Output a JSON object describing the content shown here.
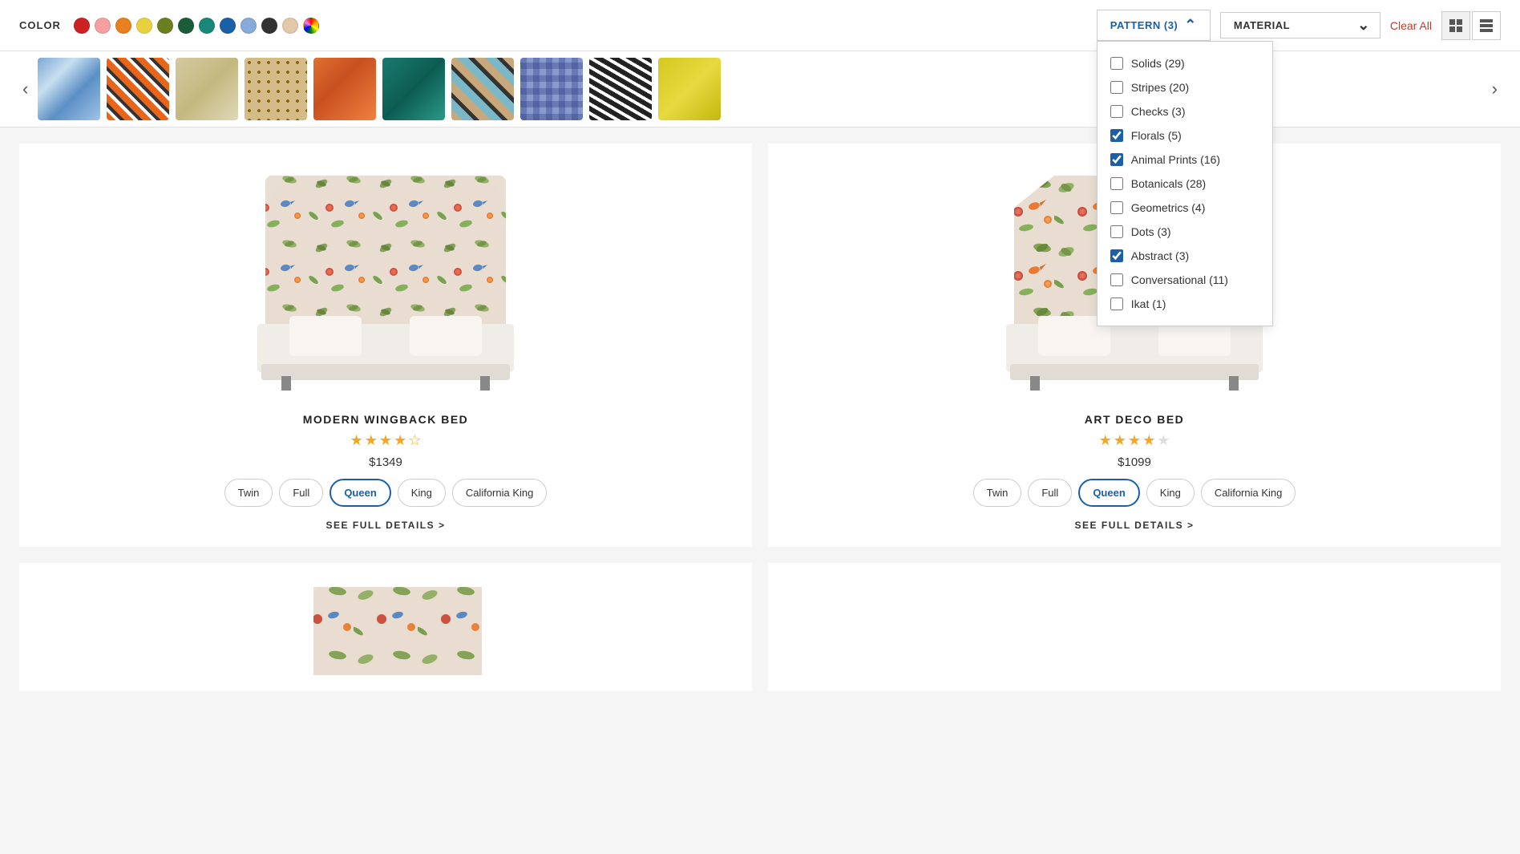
{
  "filterBar": {
    "colorLabel": "COLOR",
    "colors": [
      {
        "name": "red",
        "hex": "#cc2222"
      },
      {
        "name": "pink",
        "hex": "#f5a0a0"
      },
      {
        "name": "orange",
        "hex": "#e88020"
      },
      {
        "name": "yellow",
        "hex": "#e8d040"
      },
      {
        "name": "olive",
        "hex": "#6a8020"
      },
      {
        "name": "dark-green",
        "hex": "#1a5c38"
      },
      {
        "name": "teal",
        "hex": "#1a8878"
      },
      {
        "name": "blue",
        "hex": "#1a5fa8"
      },
      {
        "name": "light-blue",
        "hex": "#88aad8"
      },
      {
        "name": "charcoal",
        "hex": "#333333"
      },
      {
        "name": "tan",
        "hex": "#e0c8a8"
      },
      {
        "name": "multicolor",
        "hex": "multicolor"
      }
    ]
  },
  "patternDropdown": {
    "label": "PATTERN (3)",
    "isOpen": true,
    "items": [
      {
        "label": "Solids",
        "count": 29,
        "checked": false
      },
      {
        "label": "Stripes",
        "count": 20,
        "checked": false
      },
      {
        "label": "Checks",
        "count": 3,
        "checked": false
      },
      {
        "label": "Florals",
        "count": 5,
        "checked": true
      },
      {
        "label": "Animal Prints",
        "count": 16,
        "checked": true
      },
      {
        "label": "Botanicals",
        "count": 28,
        "checked": false
      },
      {
        "label": "Geometrics",
        "count": 4,
        "checked": false
      },
      {
        "label": "Dots",
        "count": 3,
        "checked": false
      },
      {
        "label": "Abstract",
        "count": 3,
        "checked": true
      },
      {
        "label": "Conversational",
        "count": 11,
        "checked": false
      },
      {
        "label": "Ikat",
        "count": 1,
        "checked": false
      }
    ]
  },
  "materialDropdown": {
    "label": "MATERIAL",
    "placeholder": "MATERIAL"
  },
  "clearAllLabel": "Clear All",
  "viewToggle": {
    "gridActive": true,
    "listActive": false
  },
  "swatches": [
    {
      "name": "blue-floral",
      "class": "swatch-blue-floral"
    },
    {
      "name": "orange-zebra",
      "class": "swatch-orange-zebra"
    },
    {
      "name": "beige-animal",
      "class": "swatch-beige-animal"
    },
    {
      "name": "tan-dots",
      "class": "swatch-tan-dots"
    },
    {
      "name": "orange-cheetah",
      "class": "swatch-orange-cheetah"
    },
    {
      "name": "teal",
      "class": "swatch-teal"
    },
    {
      "name": "stripe",
      "class": "swatch-stripe"
    },
    {
      "name": "blue-check",
      "class": "swatch-blue-check"
    },
    {
      "name": "bw-zebra",
      "class": "swatch-bw-zebra"
    },
    {
      "name": "yellow",
      "class": "swatch-yellow"
    }
  ],
  "products": [
    {
      "id": "modern-wingback-bed",
      "name": "MODERN WINGBACK BED",
      "price": "$1349",
      "starsData": [
        true,
        true,
        true,
        true,
        "half"
      ],
      "sizes": [
        "Twin",
        "Full",
        "Queen",
        "King",
        "California King"
      ],
      "activeSize": "Queen",
      "detailsLabel": "SEE FULL DETAILS >"
    },
    {
      "id": "art-deco-bed",
      "name": "ART DECO BED",
      "price": "$1099",
      "starsData": [
        true,
        true,
        true,
        true,
        false
      ],
      "sizes": [
        "Twin",
        "Full",
        "Queen",
        "King",
        "California King"
      ],
      "activeSize": "Queen",
      "detailsLabel": "SEE FULL DETAILS >"
    }
  ],
  "partialProduct": {
    "id": "third-bed"
  }
}
